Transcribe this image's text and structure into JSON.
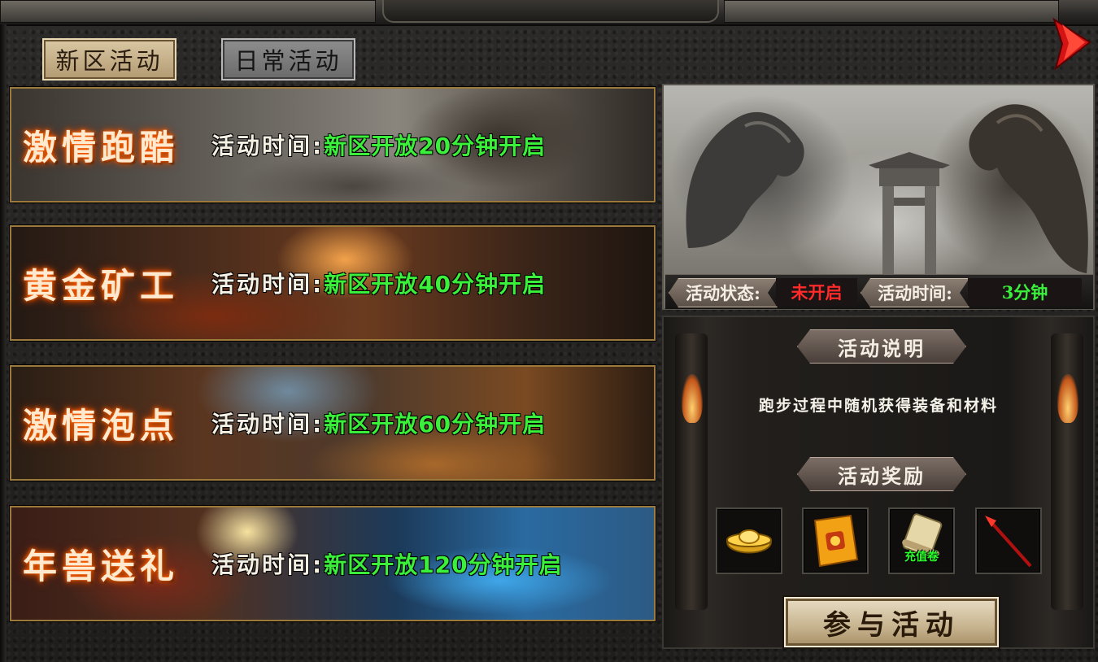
{
  "title": "",
  "tabs": [
    {
      "label": "新区活动",
      "active": true
    },
    {
      "label": "日常活动",
      "active": false
    }
  ],
  "activities": [
    {
      "name": "激情跑酷",
      "time_label": "活动时间:",
      "time_value": "新区开放20分钟开启"
    },
    {
      "name": "黄金矿工",
      "time_label": "活动时间:",
      "time_value": "新区开放40分钟开启"
    },
    {
      "name": "激情泡点",
      "time_label": "活动时间:",
      "time_value": "新区开放60分钟开启"
    },
    {
      "name": "年兽送礼",
      "time_label": "活动时间:",
      "time_value": "新区开放120分钟开启"
    }
  ],
  "detail": {
    "status_label": "活动状态:",
    "status_value": "未开启",
    "duration_label": "活动时间:",
    "duration_value": "3分钟",
    "description_heading": "活动说明",
    "description": "跑步过程中随机获得装备和材料",
    "rewards_heading": "活动奖励",
    "rewards": [
      {
        "icon": "gold-ingot-icon",
        "caption": ""
      },
      {
        "icon": "gold-ticket-icon",
        "caption": ""
      },
      {
        "icon": "scroll-icon",
        "caption": "充值卷"
      },
      {
        "icon": "red-spear-icon",
        "caption": ""
      }
    ],
    "join_button": "参与活动"
  },
  "colors": {
    "time_value": "#3af03a",
    "status_inactive": "#ff2a2a",
    "tab_active": "#d9c8a4",
    "tab_inactive": "#8e8e8e"
  }
}
